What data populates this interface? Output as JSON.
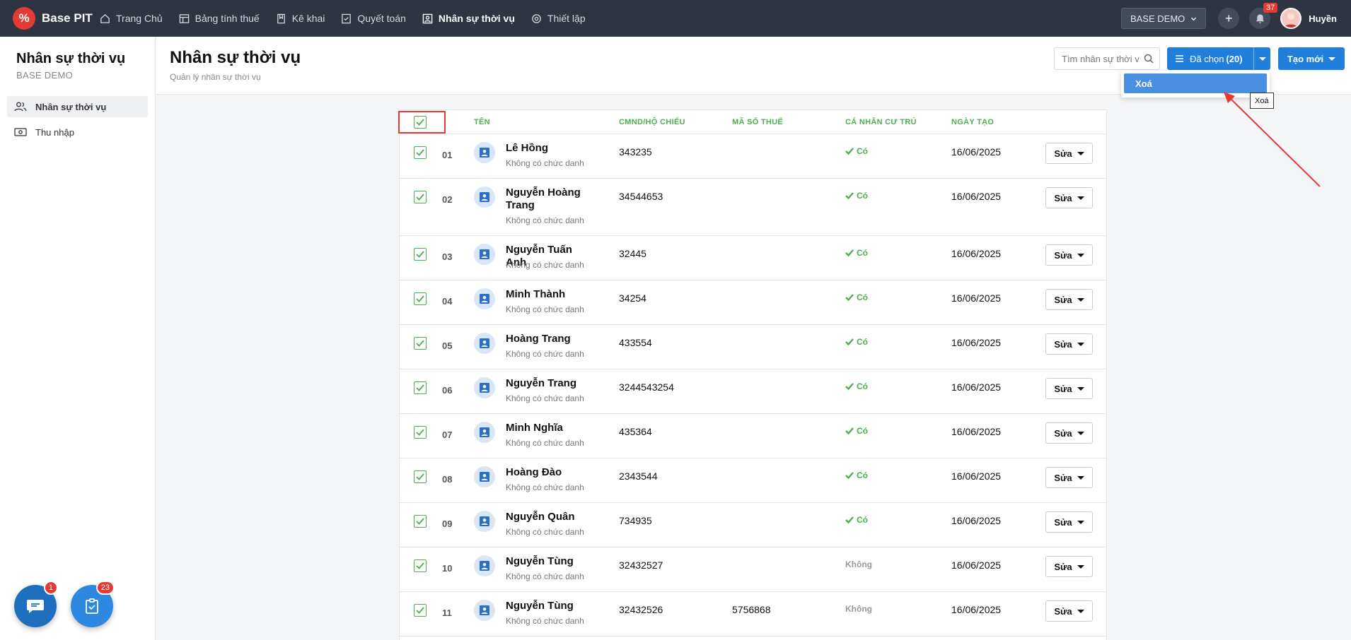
{
  "brand": {
    "logo": "%",
    "name": "Base PIT"
  },
  "nav": [
    {
      "label": "Trang Chủ",
      "icon": "home-icon",
      "active": false
    },
    {
      "label": "Bảng tính thuế",
      "icon": "table-icon",
      "active": false
    },
    {
      "label": "Kê khai",
      "icon": "document-icon",
      "active": false
    },
    {
      "label": "Quyết toán",
      "icon": "checklist-icon",
      "active": false
    },
    {
      "label": "Nhân sự thời vụ",
      "icon": "person-card-icon",
      "active": true
    },
    {
      "label": "Thiết lập",
      "icon": "gear-icon",
      "active": false
    }
  ],
  "topbar": {
    "company": "BASE DEMO",
    "plus": "+",
    "notification_count": "37",
    "user_name": "Huyền"
  },
  "sidebar": {
    "title": "Nhân sự thời vụ",
    "subtitle": "BASE DEMO",
    "items": [
      {
        "label": "Nhân sự thời vụ",
        "icon": "people-icon",
        "active": true
      },
      {
        "label": "Thu nhập",
        "icon": "money-icon",
        "active": false
      }
    ],
    "chat_badge": "1",
    "tasks_badge": "23"
  },
  "header": {
    "title": "Nhân sự thời vụ",
    "subtitle": "Quản lý nhân sự thời vụ",
    "search_placeholder": "Tìm nhân sự thời vụ",
    "selected_label": "Đã chọn",
    "selected_count": "(20)",
    "new_label": "Tạo mới"
  },
  "dropdown": {
    "delete_label": "Xoá",
    "tooltip": "Xoá"
  },
  "colors": {
    "nav_bg": "#2e3440",
    "primary": "#1f7fdb",
    "success": "#4caf50",
    "highlight": "#e53935"
  },
  "table": {
    "columns": [
      "TÊN",
      "CMND/HỘ CHIẾU",
      "MÃ SỐ THUẾ",
      "CÁ NHÂN CƯ TRÚ",
      "NGÀY TẠO"
    ],
    "edit_label": "Sửa",
    "rows": [
      {
        "num": "01",
        "name": "Lê Hồng",
        "role": "Không có chức danh",
        "id": "343235",
        "tax": "",
        "resident": "Có",
        "resident_yes": true,
        "date": "16/06/2025"
      },
      {
        "num": "02",
        "name": "Nguyễn Hoàng Trang",
        "role": "Không có chức danh",
        "id": "34544653",
        "tax": "",
        "resident": "Có",
        "resident_yes": true,
        "date": "16/06/2025"
      },
      {
        "num": "03",
        "name": "Nguyễn Tuấn Anh",
        "role": "Không có chức danh",
        "id": "32445",
        "tax": "",
        "resident": "Có",
        "resident_yes": true,
        "date": "16/06/2025"
      },
      {
        "num": "04",
        "name": "Minh Thành",
        "role": "Không có chức danh",
        "id": "34254",
        "tax": "",
        "resident": "Có",
        "resident_yes": true,
        "date": "16/06/2025"
      },
      {
        "num": "05",
        "name": "Hoàng Trang",
        "role": "Không có chức danh",
        "id": "433554",
        "tax": "",
        "resident": "Có",
        "resident_yes": true,
        "date": "16/06/2025"
      },
      {
        "num": "06",
        "name": "Nguyễn Trang",
        "role": "Không có chức danh",
        "id": "3244543254",
        "tax": "",
        "resident": "Có",
        "resident_yes": true,
        "date": "16/06/2025"
      },
      {
        "num": "07",
        "name": "Minh Nghĩa",
        "role": "Không có chức danh",
        "id": "435364",
        "tax": "",
        "resident": "Có",
        "resident_yes": true,
        "date": "16/06/2025"
      },
      {
        "num": "08",
        "name": "Hoàng Đào",
        "role": "Không có chức danh",
        "id": "2343544",
        "tax": "",
        "resident": "Có",
        "resident_yes": true,
        "date": "16/06/2025"
      },
      {
        "num": "09",
        "name": "Nguyễn Quân",
        "role": "Không có chức danh",
        "id": "734935",
        "tax": "",
        "resident": "Có",
        "resident_yes": true,
        "date": "16/06/2025"
      },
      {
        "num": "10",
        "name": "Nguyễn Tùng",
        "role": "Không có chức danh",
        "id": "32432527",
        "tax": "",
        "resident": "Không",
        "resident_yes": false,
        "date": "16/06/2025"
      },
      {
        "num": "11",
        "name": "Nguyễn Tùng",
        "role": "Không có chức danh",
        "id": "32432526",
        "tax": "5756868",
        "resident": "Không",
        "resident_yes": false,
        "date": "16/06/2025"
      }
    ]
  }
}
